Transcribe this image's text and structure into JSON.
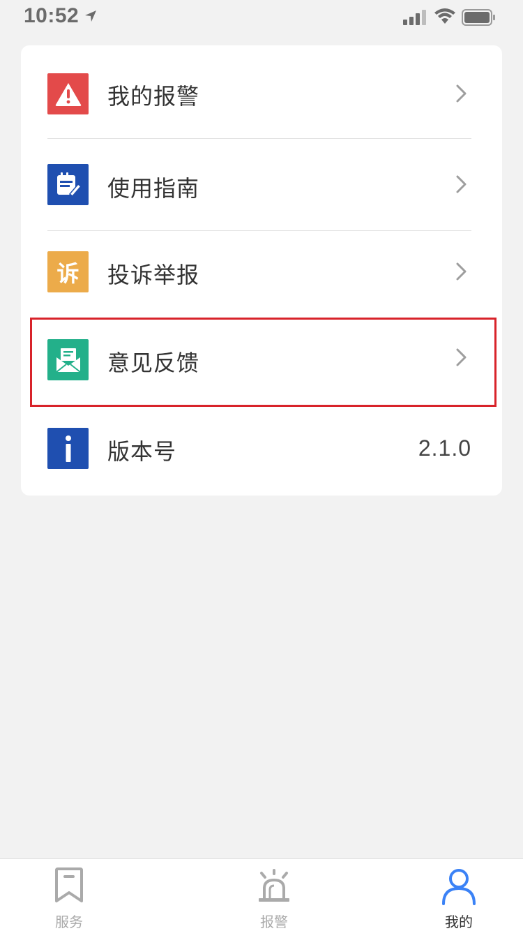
{
  "status_bar": {
    "time": "10:52"
  },
  "menu": {
    "items": [
      {
        "label": "我的报警",
        "icon": "alarm-warning-icon",
        "color": "#e34a4a"
      },
      {
        "label": "使用指南",
        "icon": "notepad-pen-icon",
        "color": "#1f4fb0"
      },
      {
        "label": "投诉举报",
        "icon": "complaint-icon",
        "icon_text": "诉",
        "color": "#ecab4a"
      },
      {
        "label": "意见反馈",
        "icon": "envelope-icon",
        "color": "#23b08a"
      },
      {
        "label": "版本号",
        "icon": "info-icon",
        "color": "#1f4fb0",
        "value": "2.1.0"
      }
    ]
  },
  "tab_bar": {
    "tabs": [
      {
        "label": "服务",
        "icon": "bookmark-icon",
        "active": false
      },
      {
        "label": "报警",
        "icon": "siren-icon",
        "active": false
      },
      {
        "label": "我的",
        "icon": "person-icon",
        "active": true
      }
    ],
    "active_color": "#3b82f6",
    "inactive_color": "#aaaaaa"
  }
}
